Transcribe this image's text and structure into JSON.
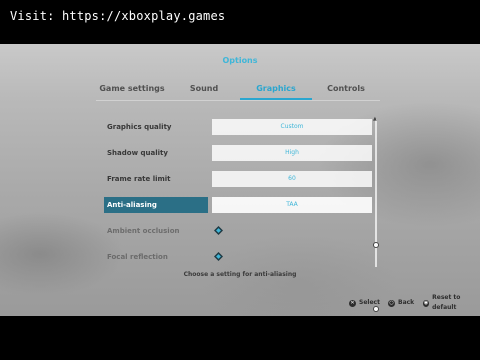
{
  "watermark": "Visit: https://xboxplay.games",
  "header": {
    "title": "Options"
  },
  "tabs": [
    {
      "label": "Game settings",
      "active": false
    },
    {
      "label": "Sound",
      "active": false
    },
    {
      "label": "Graphics",
      "active": true
    },
    {
      "label": "Controls",
      "active": false
    }
  ],
  "settings": [
    {
      "label": "Graphics quality",
      "value": "Custom",
      "kind": "select"
    },
    {
      "label": "Shadow quality",
      "value": "High",
      "kind": "select"
    },
    {
      "label": "Frame rate limit",
      "value": "60",
      "kind": "select"
    },
    {
      "label": "Anti-aliasing",
      "value": "TAA",
      "kind": "select",
      "selected": true
    },
    {
      "label": "Ambient occlusion",
      "value": "",
      "kind": "toggle"
    },
    {
      "label": "Focal reflection",
      "value": "",
      "kind": "toggle"
    }
  ],
  "hint": "Choose a setting for anti-aliasing",
  "footer": {
    "select_label": "Select",
    "back_label": "Back",
    "reset_label": "Reset to default"
  },
  "colors": {
    "accent": "#2aa6cf",
    "selected_row": "#2b6f86"
  }
}
